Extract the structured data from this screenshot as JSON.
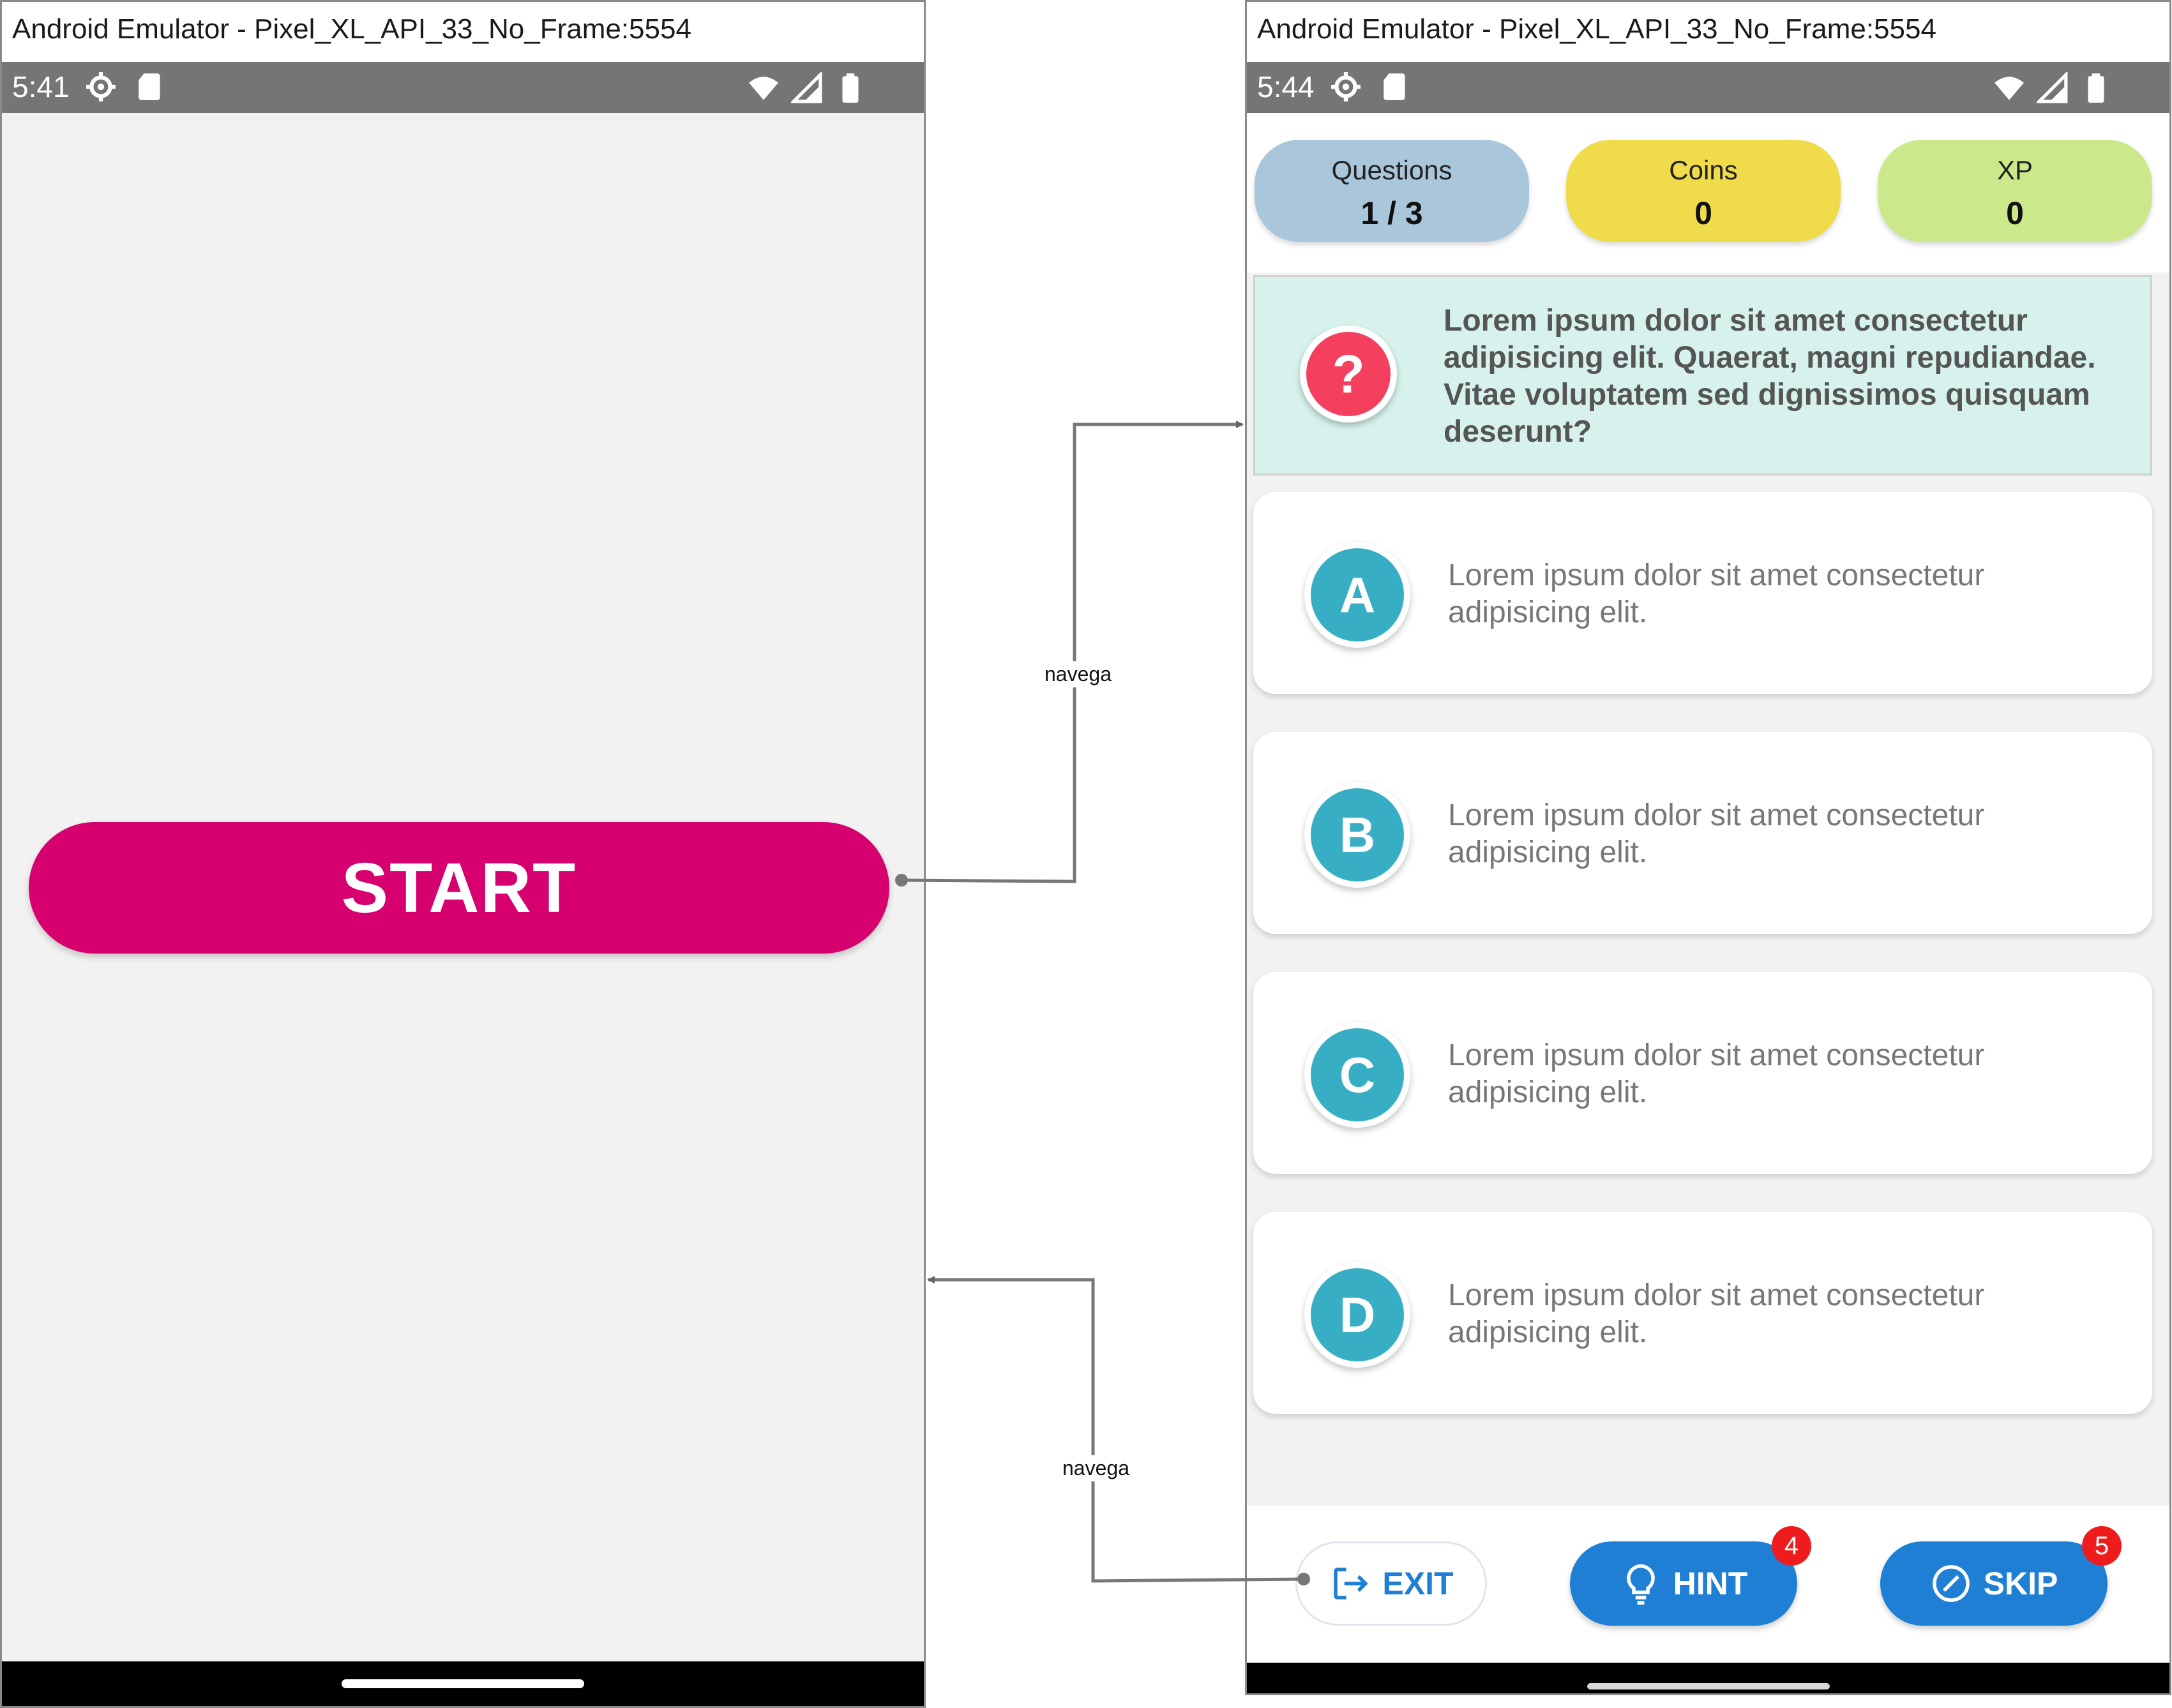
{
  "colors": {
    "start_button": "#d6006f",
    "questions_pill": "#a9c6db",
    "coins_pill": "#f0db4a",
    "xp_pill": "#cbe88a",
    "question_bg": "#d7f2ec",
    "question_icon": "#f43f5e",
    "answer_icon": "#38aec4",
    "action_blue": "#1f7fd4",
    "badge_red": "#ee1c1c",
    "status_bar": "#757575"
  },
  "left_screen": {
    "window_title": "Android Emulator - Pixel_XL_API_33_No_Frame:5554",
    "status_time": "5:41",
    "status_icons": [
      "settings-icon",
      "sd-card-icon",
      "wifi-icon",
      "signal-icon",
      "battery-icon"
    ],
    "start_label": "START"
  },
  "right_screen": {
    "window_title": "Android Emulator - Pixel_XL_API_33_No_Frame:5554",
    "status_time": "5:44",
    "status_icons": [
      "settings-icon",
      "sd-card-icon",
      "wifi-icon",
      "signal-icon",
      "battery-icon"
    ],
    "stats": {
      "questions": {
        "label": "Questions",
        "value": "1 / 3"
      },
      "coins": {
        "label": "Coins",
        "value": "0"
      },
      "xp": {
        "label": "XP",
        "value": "0"
      }
    },
    "question": {
      "icon": "?",
      "text": "Lorem ipsum dolor sit amet consectetur adipisicing elit. Quaerat, magni repudiandae. Vitae voluptatem sed dignissimos quisquam deserunt?"
    },
    "answers": [
      {
        "letter": "A",
        "text": "Lorem ipsum dolor sit amet consectetur adipisicing elit."
      },
      {
        "letter": "B",
        "text": "Lorem ipsum dolor sit amet consectetur adipisicing elit."
      },
      {
        "letter": "C",
        "text": "Lorem ipsum dolor sit amet consectetur adipisicing elit."
      },
      {
        "letter": "D",
        "text": "Lorem ipsum dolor sit amet consectetur adipisicing elit."
      }
    ],
    "actions": {
      "exit": {
        "label": "EXIT",
        "icon": "exit-icon"
      },
      "hint": {
        "label": "HINT",
        "icon": "lightbulb-icon",
        "badge": "4"
      },
      "skip": {
        "label": "SKIP",
        "icon": "skip-icon",
        "badge": "5"
      }
    }
  },
  "connectors": [
    {
      "from": "START",
      "to": "question screen",
      "label": "navega"
    },
    {
      "from": "EXIT",
      "to": "start screen",
      "label": "navega"
    }
  ]
}
